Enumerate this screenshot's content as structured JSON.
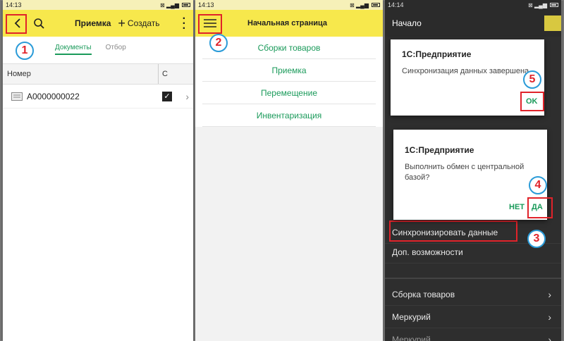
{
  "panel1": {
    "time": "14:13",
    "title": "Приемка",
    "create_label": "Создать",
    "tabs": [
      "Документы",
      "Отбор"
    ],
    "columns": [
      "Номер",
      "С"
    ],
    "rows": [
      {
        "number": "A0000000022",
        "checked": true
      }
    ],
    "step": "1"
  },
  "panel2": {
    "time": "14:13",
    "title": "Начальная страница",
    "links": [
      "Сборки товаров",
      "Приемка",
      "Перемещение",
      "Инвентаризация"
    ],
    "step": "2"
  },
  "panel3": {
    "time": "14:14",
    "title": "Начало",
    "dialog1": {
      "title": "1С:Предприятие",
      "text": "Синхронизация данных завершена.",
      "ok": "OK",
      "step": "5"
    },
    "dialog2": {
      "title": "1С:Предприятие",
      "text": "Выполнить обмен с центральной базой?",
      "no": "НЕТ",
      "yes": "ДА",
      "step": "4"
    },
    "menu": {
      "sync": "Синхронизировать данные",
      "extra": "Доп. возможности",
      "assembly": "Сборка товаров",
      "mercury": "Меркурий",
      "more": "Меркурий"
    },
    "step_sync": "3"
  }
}
